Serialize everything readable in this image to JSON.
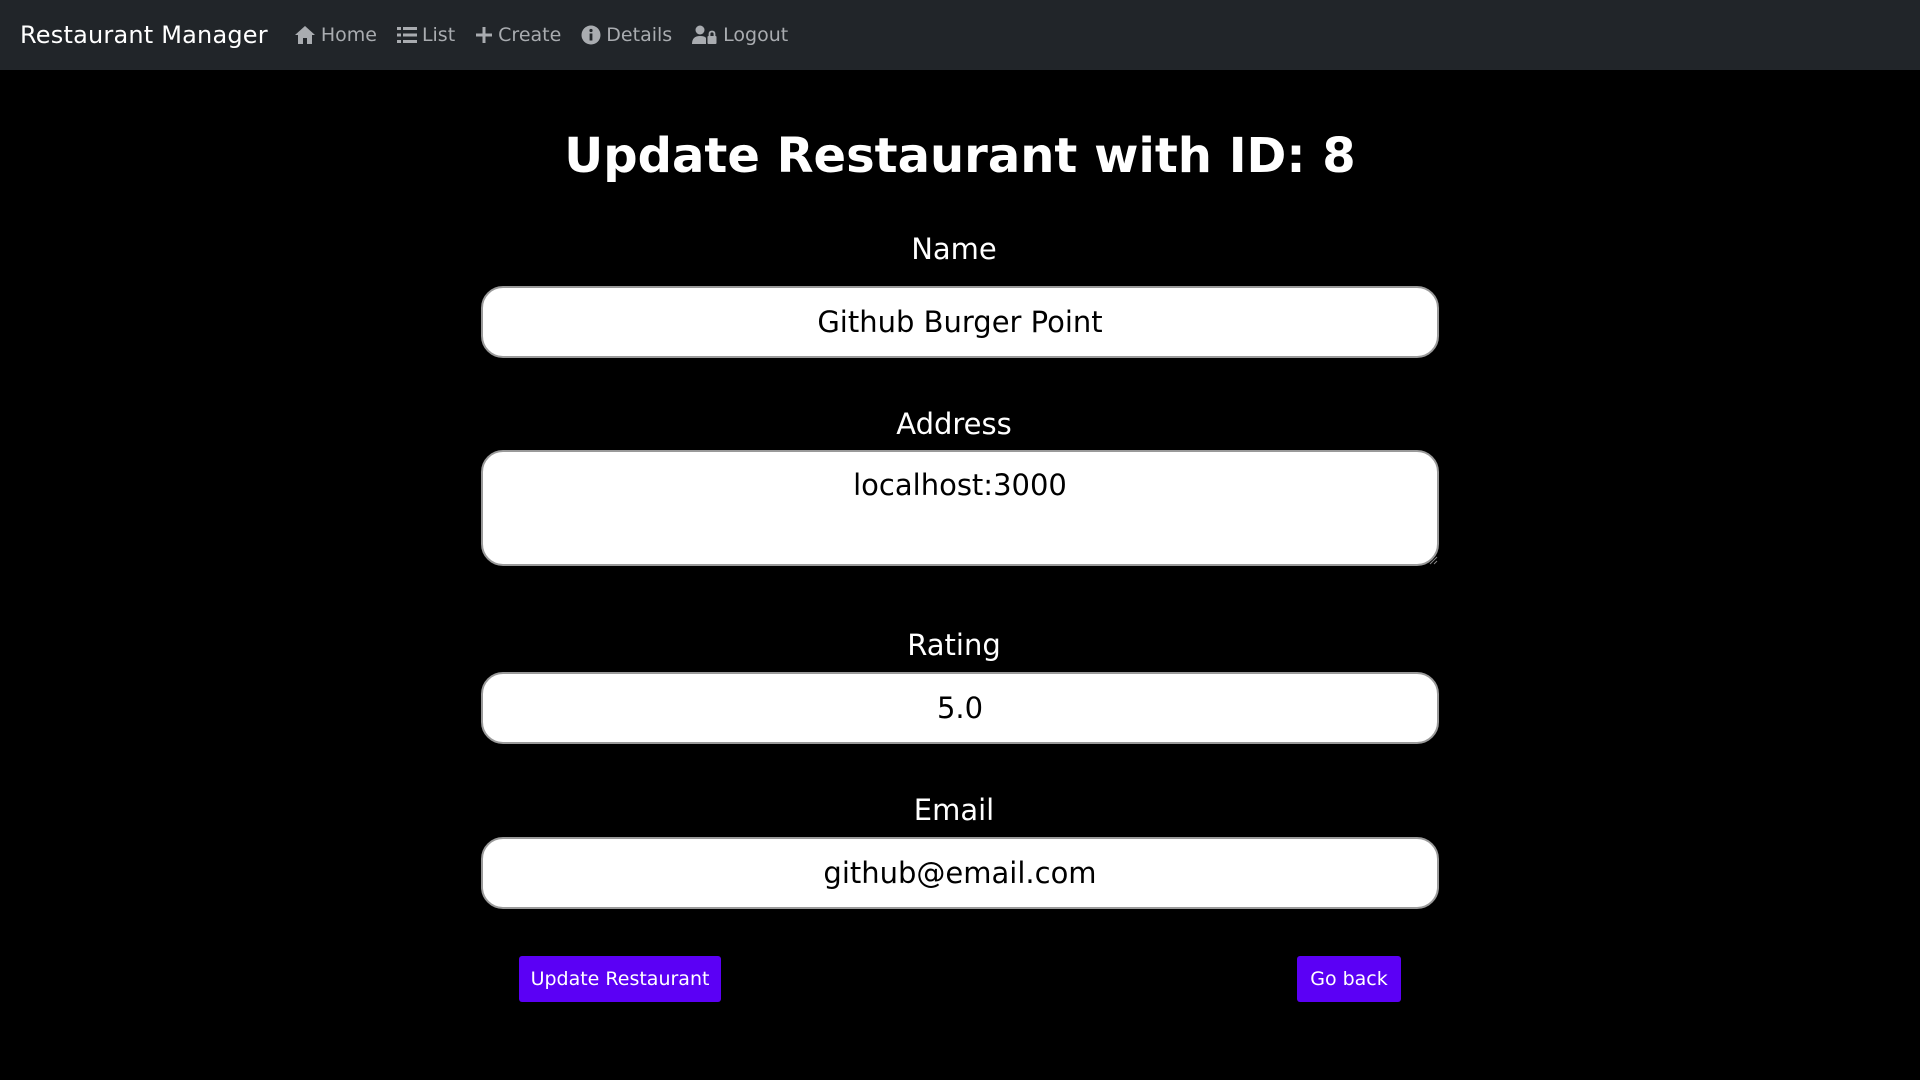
{
  "navbar": {
    "brand": "Restaurant Manager",
    "items": [
      {
        "label": "Home",
        "icon": "home-icon"
      },
      {
        "label": "List",
        "icon": "list-icon"
      },
      {
        "label": "Create",
        "icon": "plus-icon"
      },
      {
        "label": "Details",
        "icon": "info-icon"
      },
      {
        "label": "Logout",
        "icon": "user-lock-icon"
      }
    ]
  },
  "page": {
    "title": "Update Restaurant with ID: 8"
  },
  "form": {
    "name": {
      "label": "Name",
      "value": "Github Burger Point"
    },
    "address": {
      "label": "Address",
      "value": "localhost:3000"
    },
    "rating": {
      "label": "Rating",
      "value": "5.0"
    },
    "email": {
      "label": "Email",
      "value": "github@email.com"
    },
    "submit_label": "Update Restaurant",
    "back_label": "Go back"
  },
  "colors": {
    "background": "#000000",
    "navbar": "#212529",
    "button": "#5b00f5"
  }
}
